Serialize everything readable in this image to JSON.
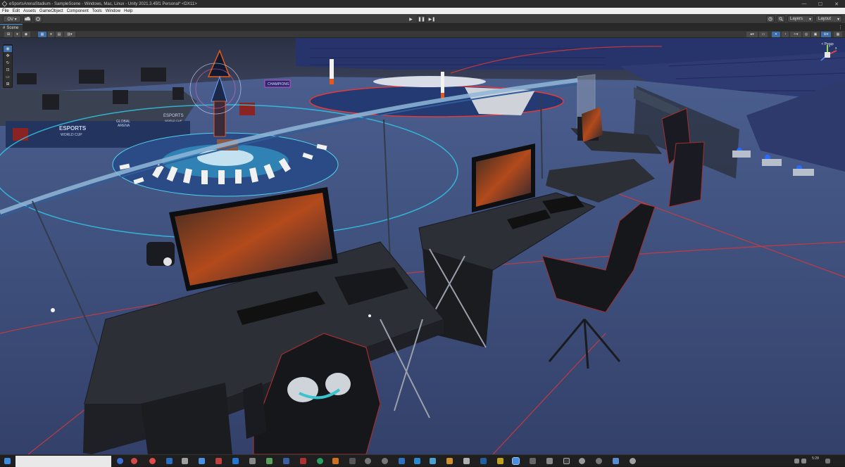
{
  "window": {
    "title": "eSportsArenaStadium - SampleScene - Windows, Mac, Linux - Unity 2021.3.45f1 Personal* <DX11>",
    "minimize_glyph": "—",
    "maximize_glyph": "☐",
    "close_glyph": "✕"
  },
  "menu": {
    "items": [
      "File",
      "Edit",
      "Assets",
      "GameObject",
      "Component",
      "Tools",
      "Window",
      "Help"
    ]
  },
  "toolbar": {
    "account_label": "OV ▾",
    "play_glyph": "▶",
    "pause_glyph": "❚❚",
    "step_glyph": "▶❚",
    "layers_label": "Layers",
    "layout_label": "Layout"
  },
  "scene_tab": {
    "label": "Scene"
  },
  "gizmo": {
    "label": "< Persp",
    "axis_y": "y",
    "axis_x": "x"
  },
  "viewport": {
    "banner_left_1": "ESPORTS",
    "banner_left_2": "WORLD CUP",
    "banner_mid_1": "GLOBAL",
    "banner_mid_2": "ARENA",
    "banner_right_1": "ESPORTS",
    "banner_right_2": "WORLD CUP",
    "banner_top": "CHAMPIONS"
  },
  "taskbar": {
    "time": "5:28"
  },
  "colors": {
    "accent": "#4a90e2",
    "floor": "#3d4d7a",
    "cyan_ring": "#31c7e6",
    "red_line": "#d9383a",
    "desk": "#2d2f36"
  }
}
